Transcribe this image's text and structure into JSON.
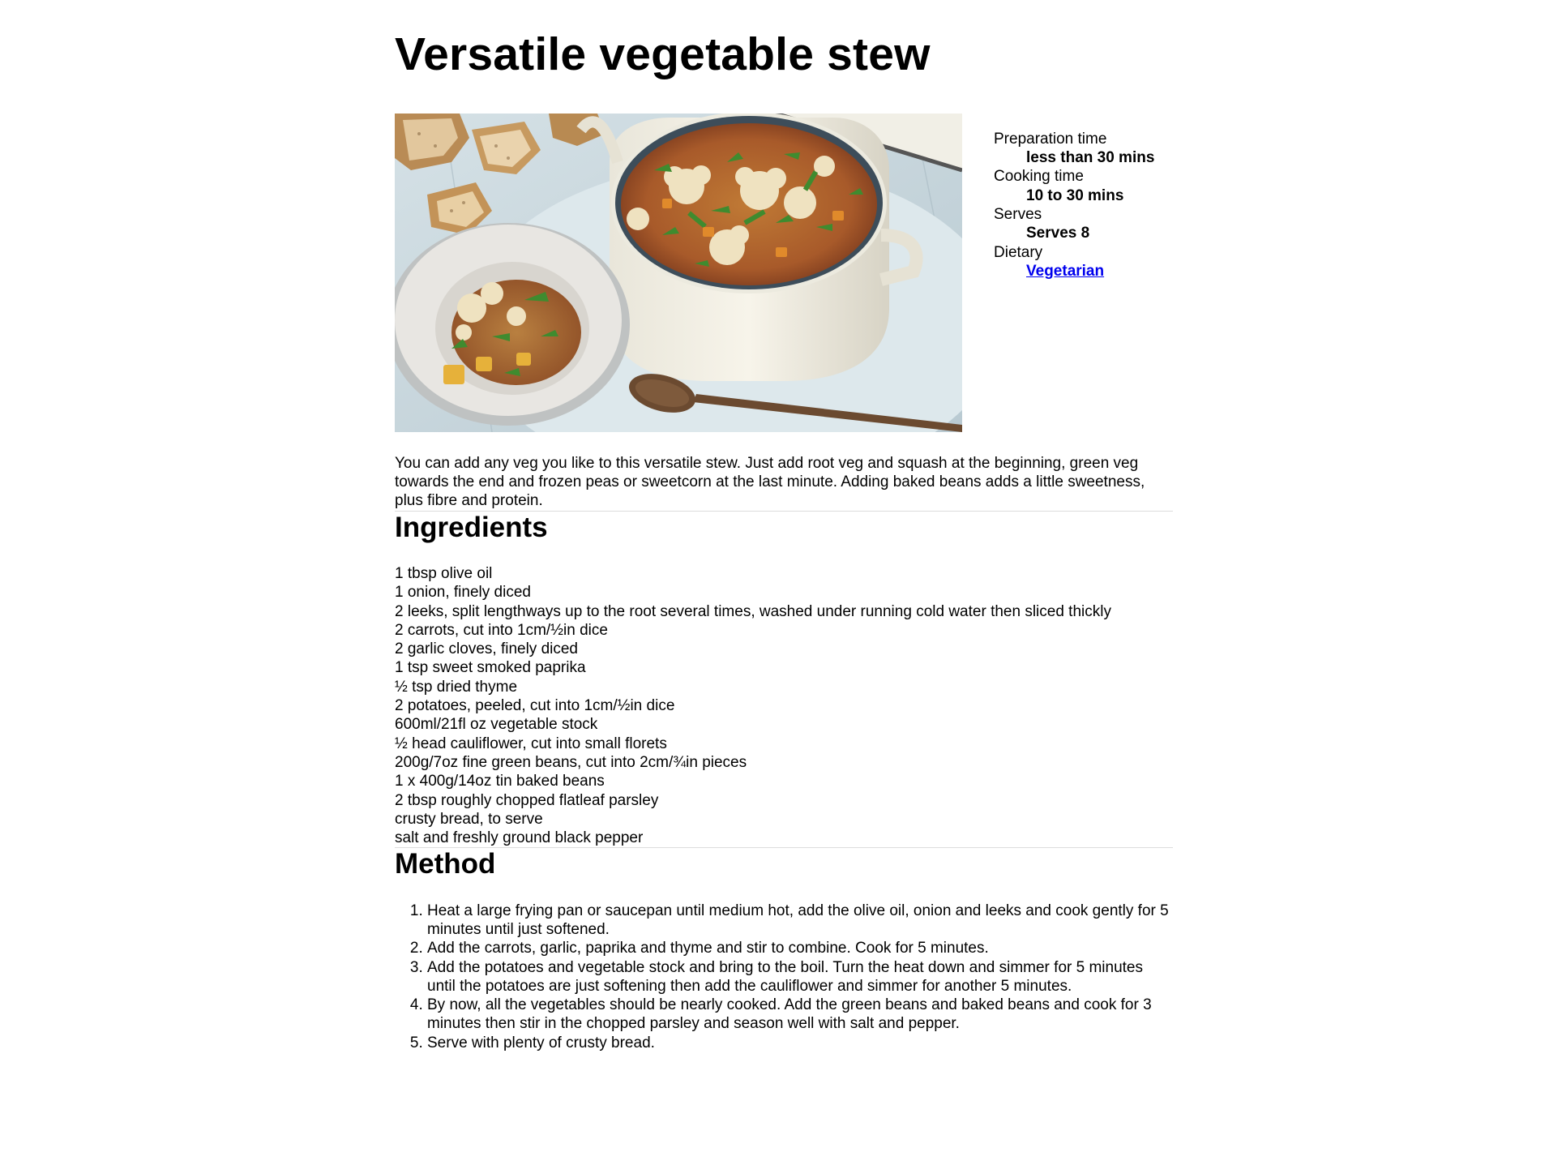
{
  "recipe": {
    "title": "Versatile vegetable stew",
    "image": {
      "alt": "Versatile vegetable stew"
    },
    "meta": {
      "prep_label": "Preparation time",
      "prep_value": "less than 30 mins",
      "cook_label": "Cooking time",
      "cook_value": "10 to 30 mins",
      "serves_label": "Serves",
      "serves_value": "Serves 8",
      "dietary_label": "Dietary",
      "dietary_value": "Vegetarian"
    },
    "description": "You can add any veg you like to this versatile stew. Just add root veg and squash at the beginning, green veg towards the end and frozen peas or sweetcorn at the last minute. Adding baked beans adds a little sweetness, plus fibre and protein.",
    "ingredients_heading": "Ingredients",
    "ingredients": [
      "1 tbsp olive oil",
      "1 onion, finely diced",
      "2 leeks, split lengthways up to the root several times, washed under running cold water then sliced thickly",
      "2 carrots, cut into 1cm/½in dice",
      "2 garlic cloves, finely diced",
      "1 tsp sweet smoked paprika",
      "½ tsp dried thyme",
      "2 potatoes, peeled, cut into 1cm/½in dice",
      "600ml/21fl oz vegetable stock",
      "½ head cauliflower, cut into small florets",
      "200g/7oz fine green beans, cut into 2cm/¾in pieces",
      "1 x 400g/14oz tin baked beans",
      "2 tbsp roughly chopped flatleaf parsley",
      "crusty bread, to serve",
      "salt and freshly ground black pepper"
    ],
    "method_heading": "Method",
    "method": [
      "Heat a large frying pan or saucepan until medium hot, add the olive oil, onion and leeks and cook gently for 5 minutes until just softened.",
      "Add the carrots, garlic, paprika and thyme and stir to combine. Cook for 5 minutes.",
      "Add the potatoes and vegetable stock and bring to the boil. Turn the heat down and simmer for 5 minutes until the potatoes are just softening then add the cauliflower and simmer for another 5 minutes.",
      "By now, all the vegetables should be nearly cooked. Add the green beans and baked beans and cook for 3 minutes then stir in the chopped parsley and season well with salt and pepper.",
      "Serve with plenty of crusty bread."
    ]
  },
  "colors": {
    "link": "#0000ee",
    "divider": "#dddddd",
    "text": "#000000"
  }
}
